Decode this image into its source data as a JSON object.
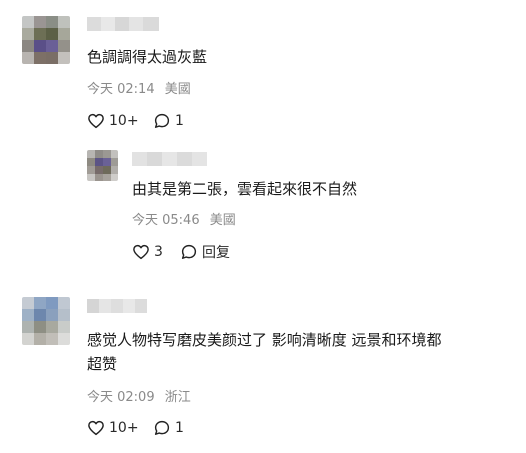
{
  "comments": [
    {
      "text": "色調調得太過灰藍",
      "time": "今天 02:14",
      "location": "美國",
      "likes": "10+",
      "replies": "1"
    },
    {
      "text": "由其是第二張，雲看起來很不自然",
      "time": "今天 05:46",
      "location": "美國",
      "likes": "3",
      "reply_label": "回复"
    },
    {
      "text_line1": "感觉人物特写磨皮美颜过了 影响清晰度 远景和环境都",
      "text_line2": "超赞",
      "time": "今天 02:09",
      "location": "浙江",
      "likes": "10+",
      "replies": "1"
    }
  ],
  "icons": {
    "like": "heart-outline-icon",
    "reply": "speech-bubble-icon"
  },
  "colors": {
    "meta_text": "#8a8a8a",
    "body_text": "#1a1a1a",
    "icon_stroke": "#222222"
  }
}
